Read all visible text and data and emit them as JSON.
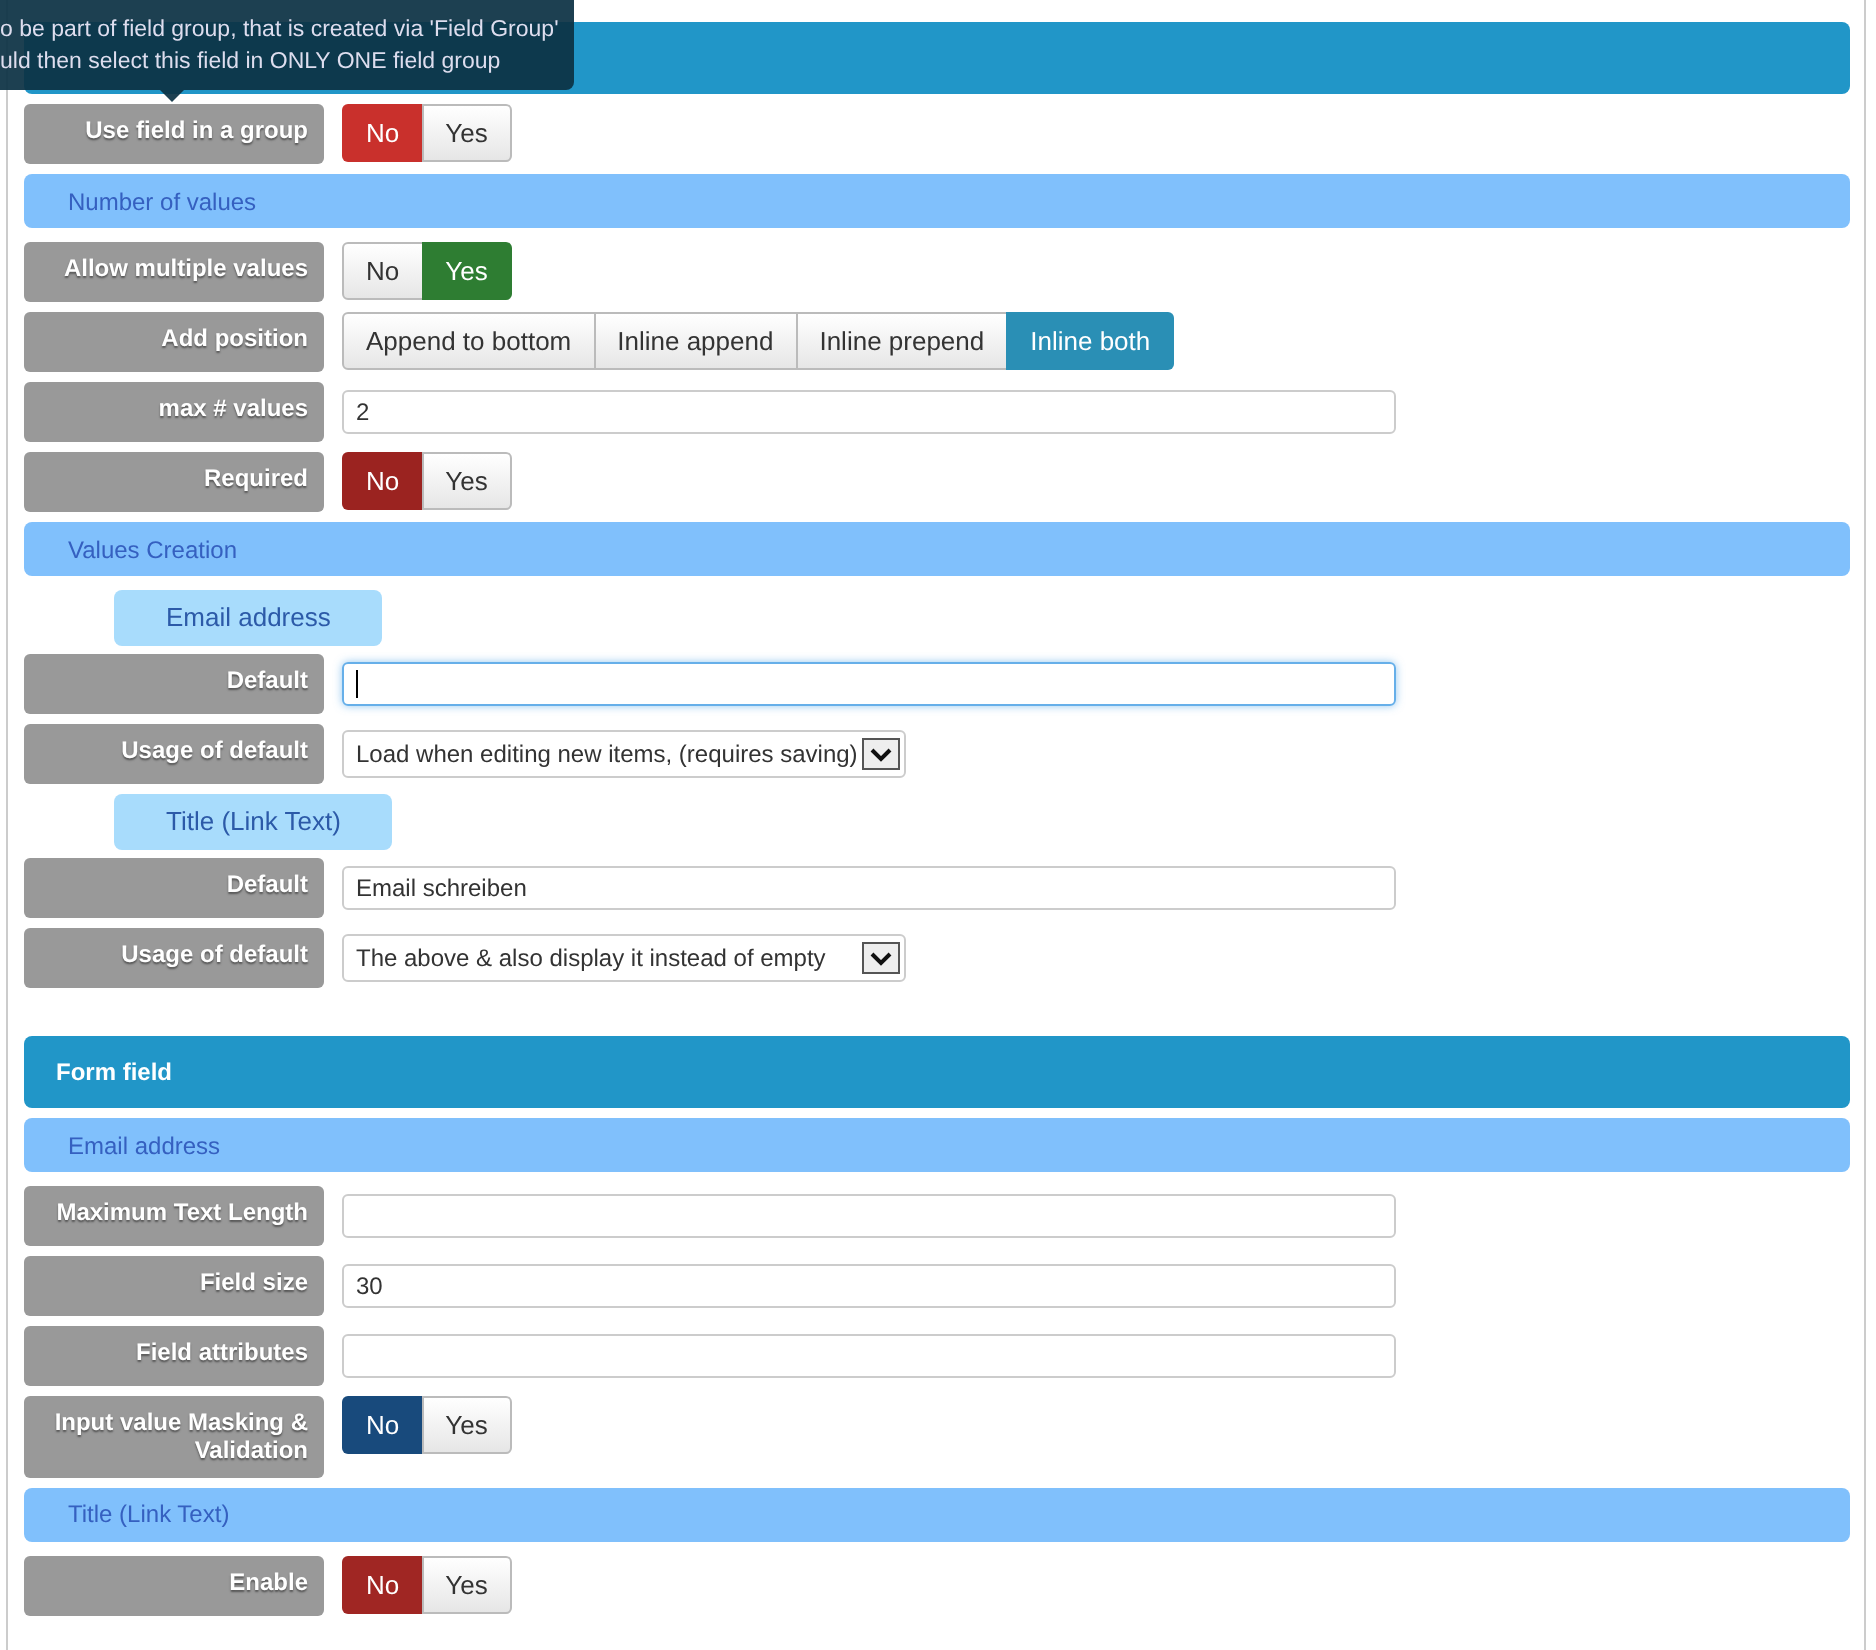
{
  "tooltip": {
    "lines": [
      "o be part of field group, that is created via 'Field Group'",
      "uld then select this field in ONLY ONE field group"
    ]
  },
  "items": [
    {
      "kind": "header"
    },
    {
      "kind": "toggle",
      "label": "Use field in a group",
      "color": "#c9302c",
      "options": [
        {
          "label": "No",
          "selected": true
        },
        {
          "label": "Yes",
          "selected": false
        }
      ]
    },
    {
      "kind": "subheader",
      "title": "Number of values"
    },
    {
      "kind": "toggle",
      "label": "Allow multiple values",
      "color": "#2e7d32",
      "options": [
        {
          "label": "No",
          "selected": false
        },
        {
          "label": "Yes",
          "selected": true
        }
      ]
    },
    {
      "kind": "toggle",
      "label": "Add position",
      "color": "#2a8fb5",
      "options": [
        {
          "label": "Append to bottom",
          "selected": false
        },
        {
          "label": "Inline append",
          "selected": false
        },
        {
          "label": "Inline prepend",
          "selected": false
        },
        {
          "label": "Inline both",
          "selected": true
        }
      ]
    },
    {
      "kind": "input",
      "label": "max # values",
      "value": "2"
    },
    {
      "kind": "toggle",
      "label": "Required",
      "color": "#9b2320",
      "options": [
        {
          "label": "No",
          "selected": true
        },
        {
          "label": "Yes",
          "selected": false
        }
      ]
    },
    {
      "kind": "subheader",
      "title": "Values Creation"
    },
    {
      "kind": "group_label",
      "title": "Email address"
    },
    {
      "kind": "input",
      "label": "Default",
      "value": "",
      "focused": true
    },
    {
      "kind": "select",
      "label": "Usage of default",
      "value": "Load when editing new items, (requires saving)"
    },
    {
      "kind": "group_label",
      "title": "Title (Link Text)"
    },
    {
      "kind": "input",
      "label": "Default",
      "value": "Email schreiben"
    },
    {
      "kind": "select",
      "label": "Usage of default",
      "value": "The above & also display it instead of empty"
    },
    {
      "kind": "header",
      "title": "Form field"
    },
    {
      "kind": "subheader",
      "title": "Email address"
    },
    {
      "kind": "input",
      "label": "Maximum Text Length",
      "value": ""
    },
    {
      "kind": "input",
      "label": "Field size",
      "value": "30"
    },
    {
      "kind": "input",
      "label": "Field attributes",
      "value": ""
    },
    {
      "kind": "toggle",
      "label": "Input value Masking & Validation",
      "color": "#184a7c",
      "options": [
        {
          "label": "No",
          "selected": true
        },
        {
          "label": "Yes",
          "selected": false
        }
      ]
    },
    {
      "kind": "subheader",
      "title": "Title (Link Text)"
    },
    {
      "kind": "toggle",
      "label": "Enable",
      "color": "#a02623",
      "options": [
        {
          "label": "No",
          "selected": true
        },
        {
          "label": "Yes",
          "selected": false
        }
      ]
    }
  ]
}
